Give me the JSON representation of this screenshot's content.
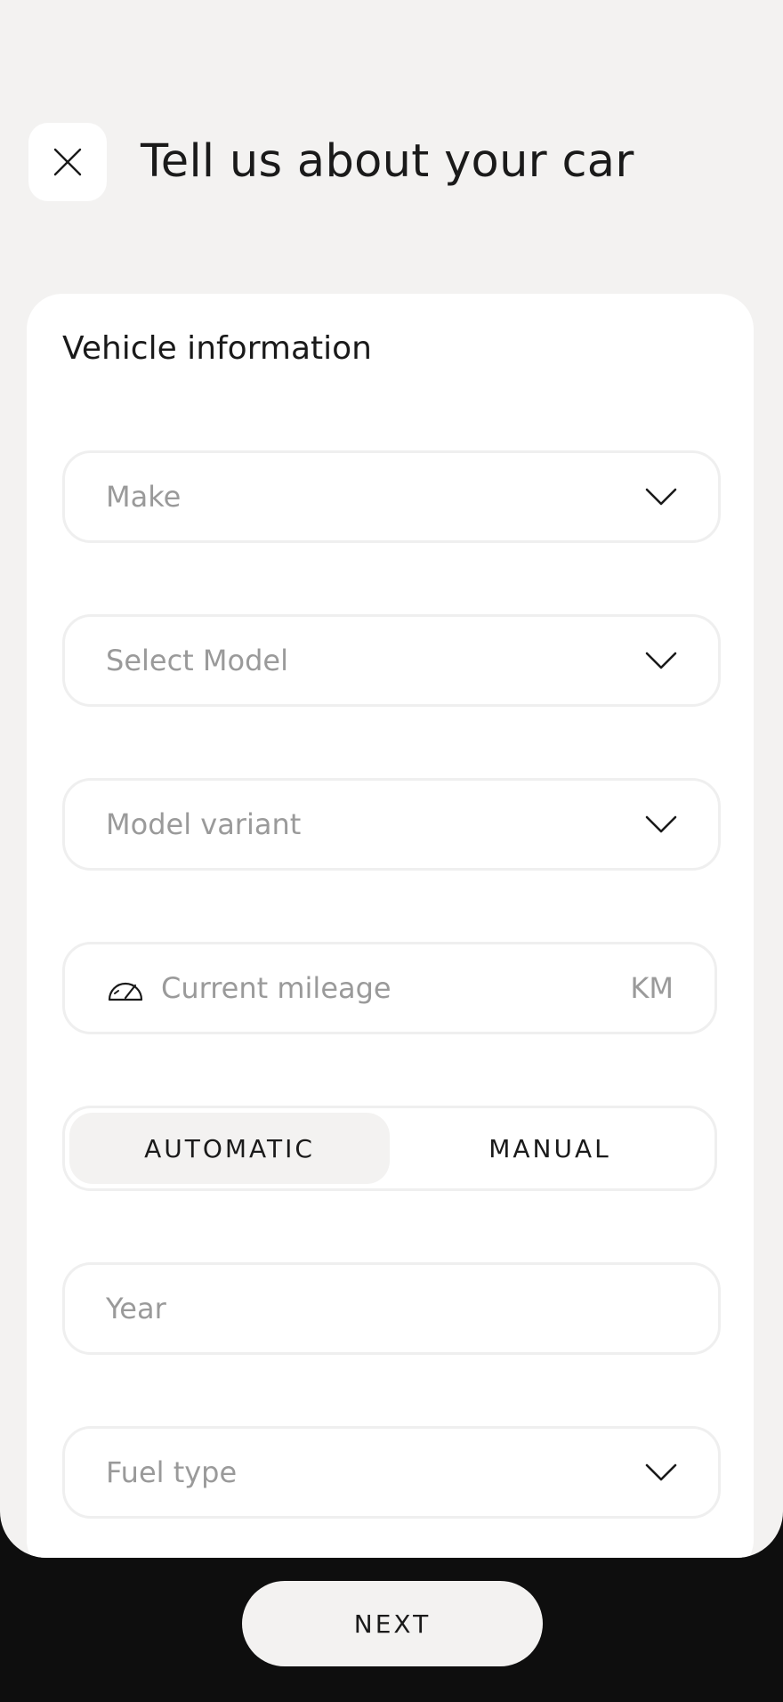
{
  "header": {
    "title": "Tell us about your car",
    "close_icon": "close-icon"
  },
  "form": {
    "section_title": "Vehicle information",
    "make": {
      "placeholder": "Make",
      "icon": "chevron-down-icon"
    },
    "model": {
      "placeholder": "Select Model",
      "icon": "chevron-down-icon"
    },
    "variant": {
      "placeholder": "Model variant",
      "icon": "chevron-down-icon"
    },
    "mileage": {
      "placeholder": "Current mileage",
      "unit": "KM",
      "icon": "speedometer-icon"
    },
    "transmission": {
      "options": [
        "AUTOMATIC",
        "MANUAL"
      ],
      "selected": "AUTOMATIC"
    },
    "year": {
      "placeholder": "Year"
    },
    "fuel": {
      "placeholder": "Fuel type",
      "icon": "chevron-down-icon"
    }
  },
  "footer": {
    "next_label": "NEXT"
  },
  "colors": {
    "sheet_background": "#f3f2f1",
    "card_background": "#ffffff",
    "footer_background": "#0e0e0e",
    "placeholder_text": "#9a9a9a",
    "primary_text": "#1a1a1a"
  }
}
